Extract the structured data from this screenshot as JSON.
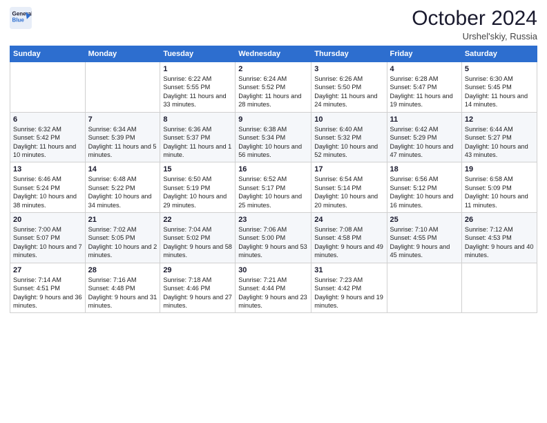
{
  "header": {
    "logo_line1": "General",
    "logo_line2": "Blue",
    "month": "October 2024",
    "location": "Urshel'skiy, Russia"
  },
  "weekdays": [
    "Sunday",
    "Monday",
    "Tuesday",
    "Wednesday",
    "Thursday",
    "Friday",
    "Saturday"
  ],
  "weeks": [
    [
      {
        "day": "",
        "sunrise": "",
        "sunset": "",
        "daylight": ""
      },
      {
        "day": "",
        "sunrise": "",
        "sunset": "",
        "daylight": ""
      },
      {
        "day": "1",
        "sunrise": "Sunrise: 6:22 AM",
        "sunset": "Sunset: 5:55 PM",
        "daylight": "Daylight: 11 hours and 33 minutes."
      },
      {
        "day": "2",
        "sunrise": "Sunrise: 6:24 AM",
        "sunset": "Sunset: 5:52 PM",
        "daylight": "Daylight: 11 hours and 28 minutes."
      },
      {
        "day": "3",
        "sunrise": "Sunrise: 6:26 AM",
        "sunset": "Sunset: 5:50 PM",
        "daylight": "Daylight: 11 hours and 24 minutes."
      },
      {
        "day": "4",
        "sunrise": "Sunrise: 6:28 AM",
        "sunset": "Sunset: 5:47 PM",
        "daylight": "Daylight: 11 hours and 19 minutes."
      },
      {
        "day": "5",
        "sunrise": "Sunrise: 6:30 AM",
        "sunset": "Sunset: 5:45 PM",
        "daylight": "Daylight: 11 hours and 14 minutes."
      }
    ],
    [
      {
        "day": "6",
        "sunrise": "Sunrise: 6:32 AM",
        "sunset": "Sunset: 5:42 PM",
        "daylight": "Daylight: 11 hours and 10 minutes."
      },
      {
        "day": "7",
        "sunrise": "Sunrise: 6:34 AM",
        "sunset": "Sunset: 5:39 PM",
        "daylight": "Daylight: 11 hours and 5 minutes."
      },
      {
        "day": "8",
        "sunrise": "Sunrise: 6:36 AM",
        "sunset": "Sunset: 5:37 PM",
        "daylight": "Daylight: 11 hours and 1 minute."
      },
      {
        "day": "9",
        "sunrise": "Sunrise: 6:38 AM",
        "sunset": "Sunset: 5:34 PM",
        "daylight": "Daylight: 10 hours and 56 minutes."
      },
      {
        "day": "10",
        "sunrise": "Sunrise: 6:40 AM",
        "sunset": "Sunset: 5:32 PM",
        "daylight": "Daylight: 10 hours and 52 minutes."
      },
      {
        "day": "11",
        "sunrise": "Sunrise: 6:42 AM",
        "sunset": "Sunset: 5:29 PM",
        "daylight": "Daylight: 10 hours and 47 minutes."
      },
      {
        "day": "12",
        "sunrise": "Sunrise: 6:44 AM",
        "sunset": "Sunset: 5:27 PM",
        "daylight": "Daylight: 10 hours and 43 minutes."
      }
    ],
    [
      {
        "day": "13",
        "sunrise": "Sunrise: 6:46 AM",
        "sunset": "Sunset: 5:24 PM",
        "daylight": "Daylight: 10 hours and 38 minutes."
      },
      {
        "day": "14",
        "sunrise": "Sunrise: 6:48 AM",
        "sunset": "Sunset: 5:22 PM",
        "daylight": "Daylight: 10 hours and 34 minutes."
      },
      {
        "day": "15",
        "sunrise": "Sunrise: 6:50 AM",
        "sunset": "Sunset: 5:19 PM",
        "daylight": "Daylight: 10 hours and 29 minutes."
      },
      {
        "day": "16",
        "sunrise": "Sunrise: 6:52 AM",
        "sunset": "Sunset: 5:17 PM",
        "daylight": "Daylight: 10 hours and 25 minutes."
      },
      {
        "day": "17",
        "sunrise": "Sunrise: 6:54 AM",
        "sunset": "Sunset: 5:14 PM",
        "daylight": "Daylight: 10 hours and 20 minutes."
      },
      {
        "day": "18",
        "sunrise": "Sunrise: 6:56 AM",
        "sunset": "Sunset: 5:12 PM",
        "daylight": "Daylight: 10 hours and 16 minutes."
      },
      {
        "day": "19",
        "sunrise": "Sunrise: 6:58 AM",
        "sunset": "Sunset: 5:09 PM",
        "daylight": "Daylight: 10 hours and 11 minutes."
      }
    ],
    [
      {
        "day": "20",
        "sunrise": "Sunrise: 7:00 AM",
        "sunset": "Sunset: 5:07 PM",
        "daylight": "Daylight: 10 hours and 7 minutes."
      },
      {
        "day": "21",
        "sunrise": "Sunrise: 7:02 AM",
        "sunset": "Sunset: 5:05 PM",
        "daylight": "Daylight: 10 hours and 2 minutes."
      },
      {
        "day": "22",
        "sunrise": "Sunrise: 7:04 AM",
        "sunset": "Sunset: 5:02 PM",
        "daylight": "Daylight: 9 hours and 58 minutes."
      },
      {
        "day": "23",
        "sunrise": "Sunrise: 7:06 AM",
        "sunset": "Sunset: 5:00 PM",
        "daylight": "Daylight: 9 hours and 53 minutes."
      },
      {
        "day": "24",
        "sunrise": "Sunrise: 7:08 AM",
        "sunset": "Sunset: 4:58 PM",
        "daylight": "Daylight: 9 hours and 49 minutes."
      },
      {
        "day": "25",
        "sunrise": "Sunrise: 7:10 AM",
        "sunset": "Sunset: 4:55 PM",
        "daylight": "Daylight: 9 hours and 45 minutes."
      },
      {
        "day": "26",
        "sunrise": "Sunrise: 7:12 AM",
        "sunset": "Sunset: 4:53 PM",
        "daylight": "Daylight: 9 hours and 40 minutes."
      }
    ],
    [
      {
        "day": "27",
        "sunrise": "Sunrise: 7:14 AM",
        "sunset": "Sunset: 4:51 PM",
        "daylight": "Daylight: 9 hours and 36 minutes."
      },
      {
        "day": "28",
        "sunrise": "Sunrise: 7:16 AM",
        "sunset": "Sunset: 4:48 PM",
        "daylight": "Daylight: 9 hours and 31 minutes."
      },
      {
        "day": "29",
        "sunrise": "Sunrise: 7:18 AM",
        "sunset": "Sunset: 4:46 PM",
        "daylight": "Daylight: 9 hours and 27 minutes."
      },
      {
        "day": "30",
        "sunrise": "Sunrise: 7:21 AM",
        "sunset": "Sunset: 4:44 PM",
        "daylight": "Daylight: 9 hours and 23 minutes."
      },
      {
        "day": "31",
        "sunrise": "Sunrise: 7:23 AM",
        "sunset": "Sunset: 4:42 PM",
        "daylight": "Daylight: 9 hours and 19 minutes."
      },
      {
        "day": "",
        "sunrise": "",
        "sunset": "",
        "daylight": ""
      },
      {
        "day": "",
        "sunrise": "",
        "sunset": "",
        "daylight": ""
      }
    ]
  ]
}
